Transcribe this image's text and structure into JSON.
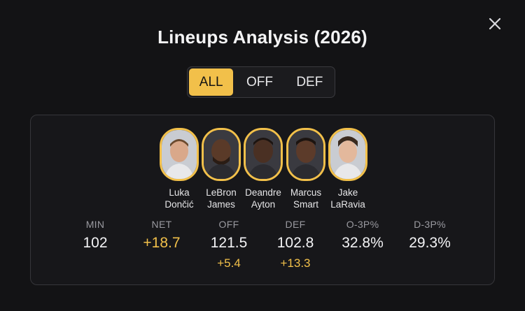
{
  "modal": {
    "title": "Lineups Analysis (2026)",
    "close_icon": "close-icon"
  },
  "filter": {
    "options": [
      "ALL",
      "OFF",
      "DEF"
    ],
    "selected": "ALL"
  },
  "lineup": {
    "players": [
      {
        "first": "Luka",
        "last": "Dončić"
      },
      {
        "first": "LeBron",
        "last": "James"
      },
      {
        "first": "Deandre",
        "last": "Ayton"
      },
      {
        "first": "Marcus",
        "last": "Smart"
      },
      {
        "first": "Jake",
        "last": "LaRavia"
      }
    ],
    "stats": [
      {
        "label": "MIN",
        "value": "102",
        "delta": ""
      },
      {
        "label": "NET",
        "value": "+18.7",
        "delta": ""
      },
      {
        "label": "OFF",
        "value": "121.5",
        "delta": "+5.4"
      },
      {
        "label": "DEF",
        "value": "102.8",
        "delta": "+13.3"
      },
      {
        "label": "O-3P%",
        "value": "32.8%",
        "delta": ""
      },
      {
        "label": "D-3P%",
        "value": "29.3%",
        "delta": ""
      }
    ]
  },
  "colors": {
    "accent": "#f2c04a",
    "background": "#131315",
    "card": "#17171a"
  }
}
